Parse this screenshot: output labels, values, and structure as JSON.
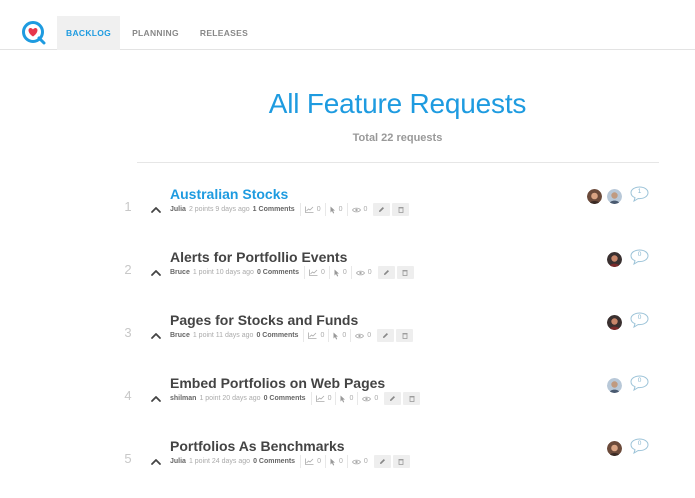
{
  "nav": {
    "tabs": [
      {
        "label": "BACKLOG",
        "active": true
      },
      {
        "label": "PLANNING",
        "active": false
      },
      {
        "label": "RELEASES",
        "active": false
      }
    ]
  },
  "header": {
    "title": "All Feature Requests",
    "subtitle": "Total 22 requests"
  },
  "colors": {
    "accent": "#1e9be0",
    "muted": "#aaaaaa"
  },
  "requests": [
    {
      "rank": "1",
      "title": "Australian Stocks",
      "author": "Julia",
      "points": "2 points 9 days ago",
      "comments": "1 Comments",
      "trend": "0",
      "clicks": "0",
      "views": "0",
      "comment_count": "1",
      "avatars": [
        "female-avatar",
        "male-avatar"
      ]
    },
    {
      "rank": "2",
      "title": "Alerts for Portfollio Events",
      "author": "Bruce",
      "points": "1 point 10 days ago",
      "comments": "0 Comments",
      "trend": "0",
      "clicks": "0",
      "views": "0",
      "comment_count": "0",
      "avatars": [
        "bruce-avatar"
      ]
    },
    {
      "rank": "3",
      "title": "Pages for Stocks and Funds",
      "author": "Bruce",
      "points": "1 point 11 days ago",
      "comments": "0 Comments",
      "trend": "0",
      "clicks": "0",
      "views": "0",
      "comment_count": "0",
      "avatars": [
        "bruce-avatar"
      ]
    },
    {
      "rank": "4",
      "title": "Embed Portfolios on Web Pages",
      "author": "shilman",
      "points": "1 point 20 days ago",
      "comments": "0 Comments",
      "trend": "0",
      "clicks": "0",
      "views": "0",
      "comment_count": "0",
      "avatars": [
        "male-avatar"
      ]
    },
    {
      "rank": "5",
      "title": "Portfolios As Benchmarks",
      "author": "Julia",
      "points": "1 point 24 days ago",
      "comments": "0 Comments",
      "trend": "0",
      "clicks": "0",
      "views": "0",
      "comment_count": "0",
      "avatars": [
        "female-avatar"
      ]
    }
  ]
}
